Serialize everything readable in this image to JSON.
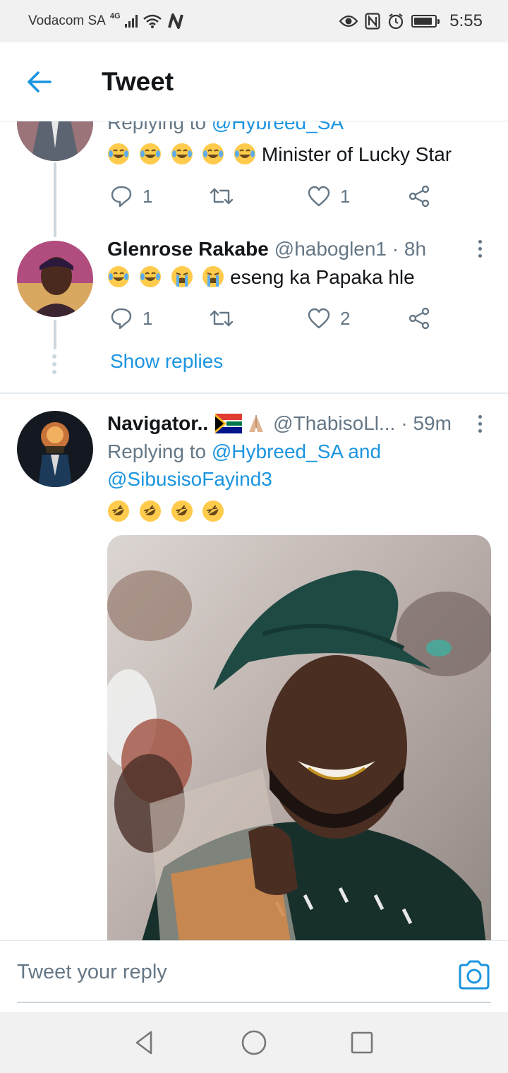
{
  "status_bar": {
    "carrier": "Vodacom SA",
    "network": "4G",
    "time": "5:55",
    "icons": [
      "signal-icon",
      "wifi-icon",
      "nfc-icon",
      "eye-icon",
      "alarm-icon",
      "battery-icon"
    ]
  },
  "header": {
    "back_icon": "arrow-left-icon",
    "title": "Tweet"
  },
  "tweets": [
    {
      "replying_prefix": "Replying to",
      "replying_to": "@Hybreed_SA",
      "emojis": [
        "joy",
        "joy",
        "joy",
        "joy",
        "joy"
      ],
      "text": "Minister of Lucky Star",
      "replies": "1",
      "retweets": "",
      "likes": "1"
    },
    {
      "name": "Glenrose Rakabe",
      "handle": "@haboglen1 · 8h",
      "emojis": [
        "joy",
        "joy",
        "sob",
        "sob"
      ],
      "text": "eseng ka Papaka hle",
      "replies": "1",
      "retweets": "",
      "likes": "2",
      "show_replies": "Show replies"
    },
    {
      "name": "Navigator..",
      "name_emojis": [
        "flag-za",
        "folded-hands"
      ],
      "handle": "@ThabisoLl...",
      "time": "· 59m",
      "replying_prefix": "Replying to",
      "replying_to": "@Hybreed_SA",
      "replying_and": "and",
      "replying_to_2": "@SibusisoFayind3",
      "emojis": [
        "rofl",
        "rofl",
        "rofl",
        "rofl"
      ],
      "media": "photo"
    }
  ],
  "reply_bar": {
    "placeholder": "Tweet your reply",
    "camera_icon": "camera-icon"
  },
  "nav_bar": {
    "icons": [
      "back-triangle-icon",
      "home-circle-icon",
      "recents-square-icon"
    ]
  },
  "colors": {
    "accent": "#1b95e0",
    "secondary_text": "#657786",
    "thread_line": "#ccd6dd"
  }
}
